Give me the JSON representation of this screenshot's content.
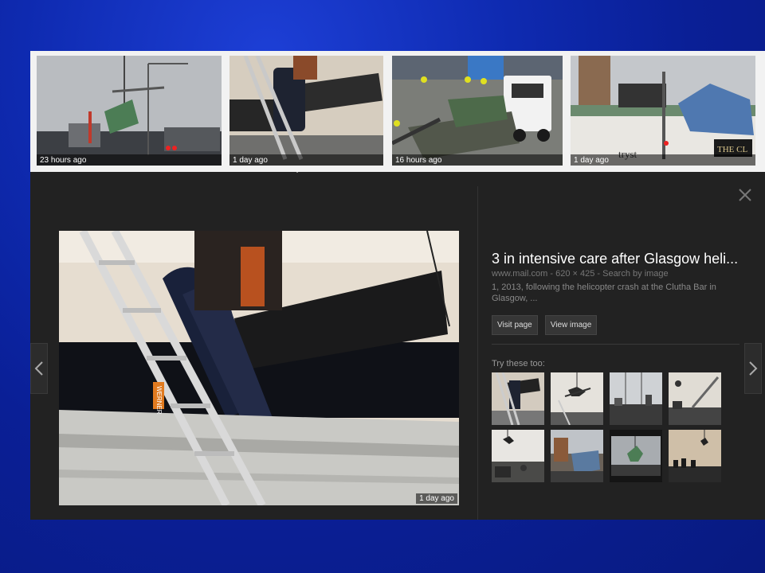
{
  "top_thumbnails": [
    {
      "age": "23 hours ago"
    },
    {
      "age": "1 day ago"
    },
    {
      "age": "16 hours ago"
    },
    {
      "age": "1 day ago"
    }
  ],
  "thumbnail_sign_text": "tryst",
  "thumbnail_sign_text_2": "THE CL",
  "detail": {
    "title": "3 in intensive care after Glasgow heli...",
    "source_site": "www.mail.com",
    "source_size": "620 × 425",
    "source_link": "Search by image",
    "description": "1, 2013, following the helicopter crash at the Clutha Bar in Glasgow, ...",
    "visit_page_label": "Visit page",
    "view_image_label": "View image",
    "main_image_age": "1 day ago",
    "try_these_label": "Try these too:",
    "ladder_label": "WERNER"
  },
  "colors": {
    "panel_bg": "#222222",
    "page_bg": "#0e2ab0",
    "strip_bg": "#f2f2f2"
  },
  "icons": [
    "close-icon",
    "chevron-left-icon",
    "chevron-right-icon"
  ]
}
